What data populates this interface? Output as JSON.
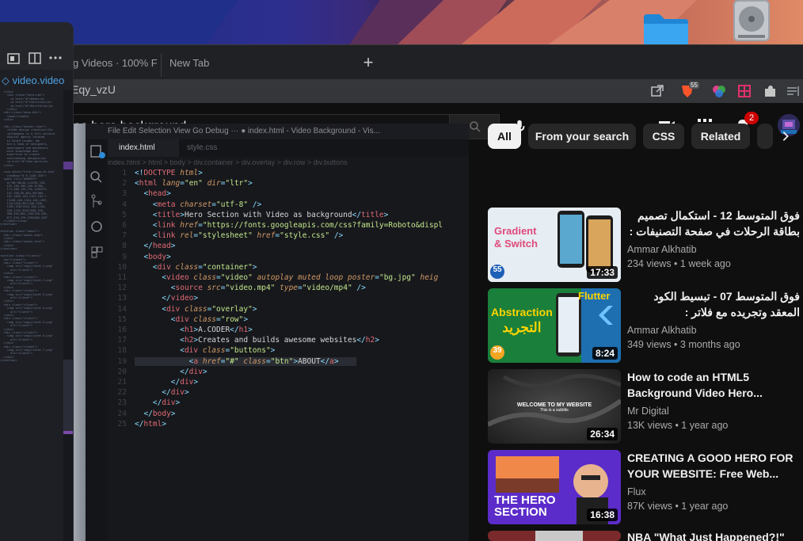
{
  "browser": {
    "tabs": [
      {
        "label": "g Videos · 100% F"
      },
      {
        "label": "New Tab"
      }
    ],
    "new_tab_symbol": "+",
    "url": "Eqy_vzU",
    "brave_badge": "55"
  },
  "youtube": {
    "search_value": "eo hero background",
    "notification_count": "2",
    "chips": [
      {
        "label": "All",
        "active": true
      },
      {
        "label": "From your search",
        "active": false
      },
      {
        "label": "CSS",
        "active": false
      },
      {
        "label": "Related",
        "active": false
      }
    ],
    "recommendations": [
      {
        "title": "فوق المتوسط 12 - استكمال تصميم بطاقة الرحلات في صفحة التصنيفات : Travel...",
        "rtl": true,
        "channel": "Ammar Alkhatib",
        "stats": "234 views • 1 week ago",
        "duration": "17:33",
        "thumb_text": [
          "Gradient",
          "& Switch"
        ],
        "thumb_badge": "55"
      },
      {
        "title": "فوق المتوسط 07 - تبسيط الكود المعقد وتجريده مع فلاتر : Abstraction -...",
        "rtl": true,
        "channel": "Ammar Alkhatib",
        "stats": "349 views • 3 months ago",
        "duration": "8:24",
        "thumb_text": [
          "Abstraction",
          "التجريد",
          "Flutter"
        ],
        "thumb_badge": "39"
      },
      {
        "title": "How to code an HTML5 Background Video Hero...",
        "rtl": false,
        "channel": "Mr Digital",
        "stats": "13K views • 1 year ago",
        "duration": "26:34",
        "thumb_text": [
          "WELCOME TO MY WEBSITE",
          "This is a subtitle"
        ]
      },
      {
        "title": "CREATING A GOOD HERO FOR YOUR WEBSITE: Free Web...",
        "rtl": false,
        "channel": "Flux",
        "stats": "87K views • 1 year ago",
        "duration": "16:38",
        "thumb_text": [
          "THE HERO",
          "SECTION"
        ]
      },
      {
        "title": "NBA \"What Just Happened?!\"",
        "rtl": false,
        "channel": "",
        "stats": "",
        "duration": "",
        "thumb_text": []
      }
    ]
  },
  "player": {
    "vscode_title": "File  Edit  Selection  View  Go  Debug   ···  ● index.html - Video Background - Vis...",
    "tab_active": "index.html",
    "tab_other": "style.css",
    "breadcrumb": "index.html > html > body > div.container > div.overlay > div.row > div.buttons"
  },
  "left_window": {
    "file_label": "video.video"
  },
  "colors": {
    "yt_bg": "#0f0f0f",
    "chip_bg": "#272727",
    "brave_orange": "#fb542b",
    "notification_red": "#cc0000",
    "folder_blue": "#2f9bf0"
  }
}
